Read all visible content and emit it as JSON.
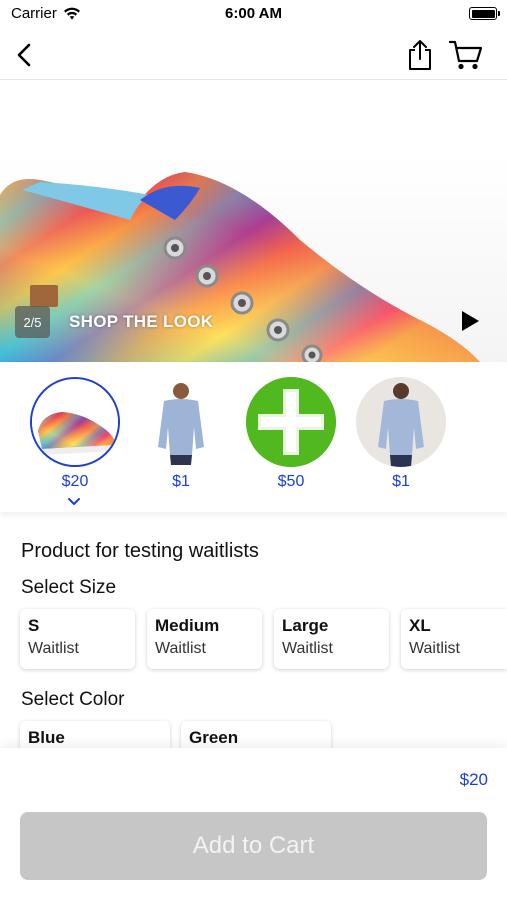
{
  "status_bar": {
    "carrier": "Carrier",
    "time": "6:00 AM"
  },
  "nav": {
    "icons": [
      "back-chevron-icon",
      "share-icon",
      "cart-icon"
    ]
  },
  "hero": {
    "counter": "2/5",
    "caption": "SHOP THE LOOK"
  },
  "thumbnails": [
    {
      "price": "$20",
      "image": "tie-dye-sneaker",
      "selected": true
    },
    {
      "price": "$1",
      "image": "man-blue-shirt"
    },
    {
      "price": "$50",
      "image": "green-plus"
    },
    {
      "price": "$1",
      "image": "man-blue-shirt"
    }
  ],
  "product": {
    "title": "Product for testing waitlists"
  },
  "size_section": {
    "label": "Select Size",
    "options": [
      {
        "name": "S",
        "status": "Waitlist"
      },
      {
        "name": "Medium",
        "status": "Waitlist"
      },
      {
        "name": "Large",
        "status": "Waitlist"
      },
      {
        "name": "XL",
        "status": "Waitlist"
      }
    ]
  },
  "color_section": {
    "label": "Select Color",
    "options": [
      {
        "name": "Blue"
      },
      {
        "name": "Green"
      }
    ]
  },
  "footer": {
    "total": "$20",
    "add_to_cart_label": "Add to Cart"
  },
  "colors": {
    "accent": "#1a3ed6",
    "disabled_button": "#c6c6c6",
    "plus_green": "#4caf1a"
  }
}
